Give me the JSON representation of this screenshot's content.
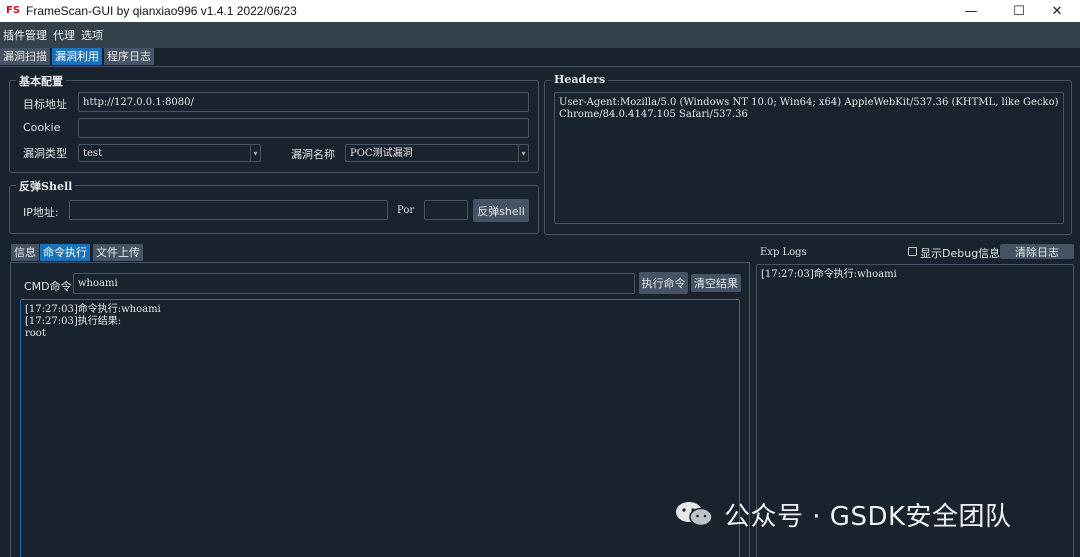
{
  "window": {
    "icon_text": "FS",
    "title": "FrameScan-GUI  by qianxiao996 v1.4.1 2022/06/23",
    "min_label": "—",
    "max_label": "☐",
    "close_label": "✕"
  },
  "menu": {
    "items": [
      "插件管理",
      "代理",
      "选项"
    ]
  },
  "top_tabs": {
    "items": [
      "漏洞扫描",
      "漏洞利用",
      "程序日志"
    ],
    "active_index": 1
  },
  "basic_config": {
    "title": "基本配置",
    "target_label": "目标地址",
    "target_value": "http://127.0.0.1:8080/",
    "cookie_label": "Cookie",
    "cookie_value": "",
    "vuln_type_label": "漏洞类型",
    "vuln_type_value": "test",
    "vuln_name_label": "漏洞名称",
    "vuln_name_value": "POC测试漏洞"
  },
  "reverse_shell": {
    "title": "反弹Shell",
    "ip_label": "IP地址:",
    "ip_value": "",
    "port_label": "Por",
    "port_value": "",
    "button_label": "反弹shell"
  },
  "headers": {
    "title": "Headers",
    "value": "User-Agent:Mozilla/5.0 (Windows NT 10.0; Win64; x64) AppleWebKit/537.36 (KHTML, like Gecko) Chrome/84.0.4147.105 Safari/537.36"
  },
  "sub_tabs": {
    "items": [
      "信息",
      "命令执行",
      "文件上传"
    ],
    "active_index": 1
  },
  "cmd": {
    "label": "CMD命令",
    "value": "whoami",
    "exec_button": "执行命令",
    "clear_button": "清空结果",
    "output": "[17:27:03]命令执行:whoami\n[17:27:03]执行结果:\nroot"
  },
  "exp_logs": {
    "title": "Exp Logs",
    "debug_checkbox_label": "显示Debug信息",
    "debug_checked": false,
    "clear_button": "清除日志",
    "content": "[17:27:03]命令执行:whoami"
  },
  "watermark": {
    "text": "公众号 · GSDK安全团队"
  }
}
